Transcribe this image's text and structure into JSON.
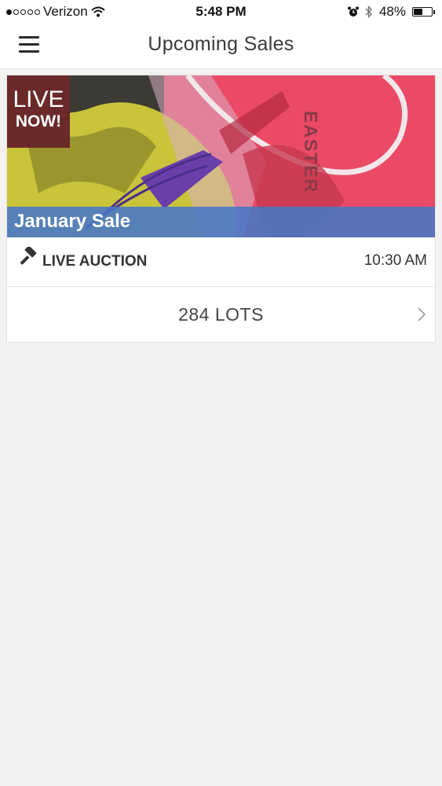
{
  "status_bar": {
    "carrier": "Verizon",
    "time": "5:48 PM",
    "battery_percent": "48%",
    "battery_level": 0.48,
    "signal_bars_filled": 1,
    "signal_bars_total": 5
  },
  "header": {
    "title": "Upcoming Sales",
    "menu_icon": "hamburger-menu-icon"
  },
  "sale_card": {
    "live_badge_line1": "LIVE",
    "live_badge_line2": "NOW!",
    "sale_name": "January Sale",
    "image_text": "EASTER",
    "auction_type": "LIVE AUCTION",
    "auction_icon": "gavel-icon",
    "time": "10:30 AM",
    "lots_label": "284 LOTS",
    "colors": {
      "live_badge": "#6a2a2a",
      "banner": "#4678c8"
    }
  }
}
